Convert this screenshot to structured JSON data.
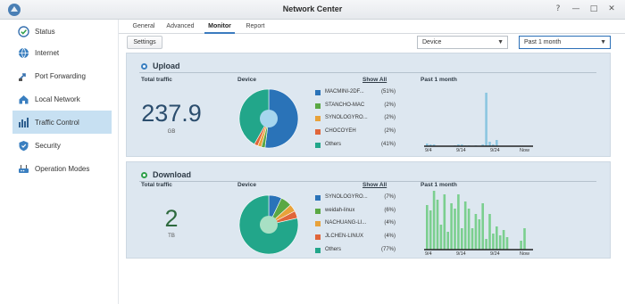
{
  "window": {
    "title": "Network Center",
    "controls": [
      "?",
      "—",
      "□",
      "✕"
    ]
  },
  "colors": {
    "accent": "#3b7bbf",
    "sidebar_active": "#c7e0f2",
    "panel_bg": "#dde7f0",
    "upload_bar": "#8cc6e0",
    "download_bar": "#7bcf8f"
  },
  "sidebar": {
    "items": [
      {
        "label": "Status",
        "icon": "status-check-icon"
      },
      {
        "label": "Internet",
        "icon": "globe-icon"
      },
      {
        "label": "Port Forwarding",
        "icon": "port-forwarding-icon"
      },
      {
        "label": "Local Network",
        "icon": "home-network-icon"
      },
      {
        "label": "Traffic Control",
        "icon": "traffic-control-icon",
        "active": true
      },
      {
        "label": "Security",
        "icon": "shield-icon"
      },
      {
        "label": "Operation Modes",
        "icon": "router-icon"
      }
    ]
  },
  "tabs": [
    "General",
    "Advanced",
    "Monitor",
    "Report"
  ],
  "active_tab": "Monitor",
  "toolbar": {
    "settings_label": "Settings",
    "device_select": "Device",
    "period_select": "Past 1 month"
  },
  "upload": {
    "title": "Upload",
    "total_label": "Total traffic",
    "total_value": "237.9",
    "total_unit": "GB",
    "device_label": "Device",
    "show_all": "Show All",
    "period_label": "Past 1 month",
    "legend": [
      {
        "name": "MACMINI-2DF...",
        "pct": "(51%)",
        "color": "#2a73b8"
      },
      {
        "name": "STANCHO-MAC",
        "pct": "(2%)",
        "color": "#5aa844"
      },
      {
        "name": "SYNOLOGYRO...",
        "pct": "(2%)",
        "color": "#e8a23a"
      },
      {
        "name": "CHOCOYEH",
        "pct": "(2%)",
        "color": "#e0663a"
      },
      {
        "name": "Others",
        "pct": "(41%)",
        "color": "#22a68a"
      }
    ],
    "pie_values": [
      51,
      2,
      2,
      2,
      41
    ],
    "x_ticks": [
      "9/4",
      "9/14",
      "9/24",
      "Now"
    ],
    "bars": [
      3,
      2,
      2,
      0,
      0,
      0,
      0,
      0,
      1,
      2,
      2,
      1,
      1,
      0,
      1,
      0,
      2,
      60,
      5,
      2,
      7,
      0,
      0,
      0,
      0,
      0,
      0,
      0,
      0,
      0
    ]
  },
  "download": {
    "title": "Download",
    "total_label": "Total traffic",
    "total_value": "2",
    "total_unit": "TB",
    "device_label": "Device",
    "show_all": "Show All",
    "period_label": "Past 1 month",
    "legend": [
      {
        "name": "SYNOLOGYRO...",
        "pct": "(7%)",
        "color": "#2a73b8"
      },
      {
        "name": "weidah-linux",
        "pct": "(6%)",
        "color": "#5aa844"
      },
      {
        "name": "NACHUANG-LI...",
        "pct": "(4%)",
        "color": "#e8a23a"
      },
      {
        "name": "JLCHEN-LINUX",
        "pct": "(4%)",
        "color": "#e0663a"
      },
      {
        "name": "Others",
        "pct": "(77%)",
        "color": "#22a68a"
      }
    ],
    "pie_values": [
      7,
      6,
      4,
      4,
      77
    ],
    "x_ticks": [
      "9/4",
      "9/14",
      "9/24",
      "Now"
    ],
    "bars": [
      50,
      44,
      80,
      56,
      28,
      62,
      20,
      52,
      46,
      62,
      24,
      54,
      46,
      24,
      40,
      34,
      52,
      12,
      40,
      18,
      26,
      16,
      22,
      14,
      0,
      0,
      0,
      10,
      24,
      0
    ]
  }
}
